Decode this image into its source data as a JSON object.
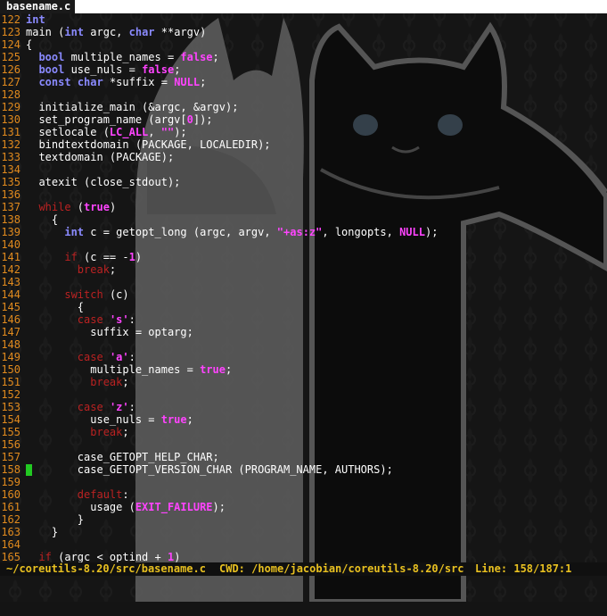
{
  "tabline": {
    "active_tab": "basename.c"
  },
  "editor": {
    "cursor_line_index": 36,
    "lines": [
      {
        "n": "122",
        "t": "int",
        "k": "type"
      },
      {
        "n": "123",
        "t": "main (int argc, char **argv)"
      },
      {
        "n": "124",
        "t": "{"
      },
      {
        "n": "125",
        "t": "  bool multiple_names = false;"
      },
      {
        "n": "126",
        "t": "  bool use_nuls = false;"
      },
      {
        "n": "127",
        "t": "  const char *suffix = NULL;"
      },
      {
        "n": "128",
        "t": ""
      },
      {
        "n": "129",
        "t": "  initialize_main (&argc, &argv);"
      },
      {
        "n": "130",
        "t": "  set_program_name (argv[0]);"
      },
      {
        "n": "131",
        "t": "  setlocale (LC_ALL, \"\");"
      },
      {
        "n": "132",
        "t": "  bindtextdomain (PACKAGE, LOCALEDIR);"
      },
      {
        "n": "133",
        "t": "  textdomain (PACKAGE);"
      },
      {
        "n": "134",
        "t": ""
      },
      {
        "n": "135",
        "t": "  atexit (close_stdout);"
      },
      {
        "n": "136",
        "t": ""
      },
      {
        "n": "137",
        "t": "  while (true)"
      },
      {
        "n": "138",
        "t": "    {"
      },
      {
        "n": "139",
        "t": "      int c = getopt_long (argc, argv, \"+as:z\", longopts, NULL);"
      },
      {
        "n": "140",
        "t": ""
      },
      {
        "n": "141",
        "t": "      if (c == -1)"
      },
      {
        "n": "142",
        "t": "        break;"
      },
      {
        "n": "143",
        "t": ""
      },
      {
        "n": "144",
        "t": "      switch (c)"
      },
      {
        "n": "145",
        "t": "        {"
      },
      {
        "n": "146",
        "t": "        case 's':"
      },
      {
        "n": "147",
        "t": "          suffix = optarg;"
      },
      {
        "n": "148",
        "t": ""
      },
      {
        "n": "149",
        "t": "        case 'a':"
      },
      {
        "n": "150",
        "t": "          multiple_names = true;"
      },
      {
        "n": "151",
        "t": "          break;"
      },
      {
        "n": "152",
        "t": ""
      },
      {
        "n": "153",
        "t": "        case 'z':"
      },
      {
        "n": "154",
        "t": "          use_nuls = true;"
      },
      {
        "n": "155",
        "t": "          break;"
      },
      {
        "n": "156",
        "t": ""
      },
      {
        "n": "157",
        "t": "        case_GETOPT_HELP_CHAR;"
      },
      {
        "n": "158",
        "t": "        case_GETOPT_VERSION_CHAR (PROGRAM_NAME, AUTHORS);"
      },
      {
        "n": "159",
        "t": ""
      },
      {
        "n": "160",
        "t": "        default:"
      },
      {
        "n": "161",
        "t": "          usage (EXIT_FAILURE);"
      },
      {
        "n": "162",
        "t": "        }"
      },
      {
        "n": "163",
        "t": "    }"
      },
      {
        "n": "164",
        "t": ""
      },
      {
        "n": "165",
        "t": "  if (argc < optind + 1)"
      }
    ]
  },
  "statusline": {
    "file": "~/coreutils-8.20/src/basename.c",
    "cwd": "CWD: /home/jacobian/coreutils-8.20/src",
    "position": "Line: 158/187:1"
  },
  "colors": {
    "line_number": "#e08a1e",
    "type": "#8a8aff",
    "keyword": "#e0e020",
    "control": "#bb2222",
    "constant": "#ff44ff",
    "cursor": "#22c922",
    "status_text": "#e8c020"
  }
}
